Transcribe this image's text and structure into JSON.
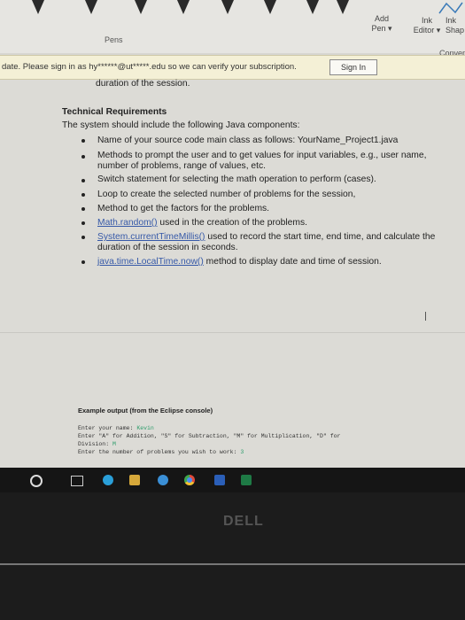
{
  "ribbon": {
    "pens_label": "Pens",
    "add_pen_label": "Add",
    "add_pen_sub": "Pen ▾",
    "ink_editor_label": "Ink",
    "ink_editor_sub": "Editor ▾",
    "ink_shape_label": "Ink",
    "ink_shape_sub": "Shap",
    "convert_label": "Conver"
  },
  "notification": {
    "text": "date. Please sign in as hy******@ut*****.edu so we can verify your subscription.",
    "button_label": "Sign In"
  },
  "document": {
    "intro_line": "duration of the session.",
    "heading": "Technical Requirements",
    "lead": "The system should include the following Java components:",
    "b1": "Name of your source code main class as follows: YourName_Project1.java",
    "b2_line1": "Methods to prompt the user and to get values for input variables, e.g., user name,",
    "b2_line2": "number of problems, range of values, etc.",
    "b3": "Switch statement for selecting the math operation to perform (cases).",
    "b4": "Loop to create the selected number of problems for the session,",
    "b5": "Method to get the factors for the problems.",
    "b6_link": "Math.random()",
    "b6_rest": " used in the creation of the problems.",
    "b7_link": "System.currentTimeMillis()",
    "b7_rest": " used to record the start time, end time, and calculate the",
    "b7_line2": "duration of the session in seconds.",
    "b8_link": "java.time.LocalTime.now()",
    "b8_rest": " method to display date and time of session.",
    "example_label": "Example output (from the Eclipse console)",
    "console": {
      "line1_prompt": "Enter your name: ",
      "line1_value": "Kevin",
      "line2": "Enter \"A\" for Addition, \"S\" for Subtraction, \"M\" for Multiplication, \"D\" for",
      "line3_prompt": "Division: ",
      "line3_value": "M",
      "line4_prompt": "Enter the number of problems you wish to work: ",
      "line4_value": "3"
    }
  },
  "taskbar": {
    "chrome_color": "#4b8bf5",
    "word_color": "#2b5fb8",
    "excel_color": "#1e7a45"
  },
  "bezel": {
    "brand": "DELL"
  }
}
